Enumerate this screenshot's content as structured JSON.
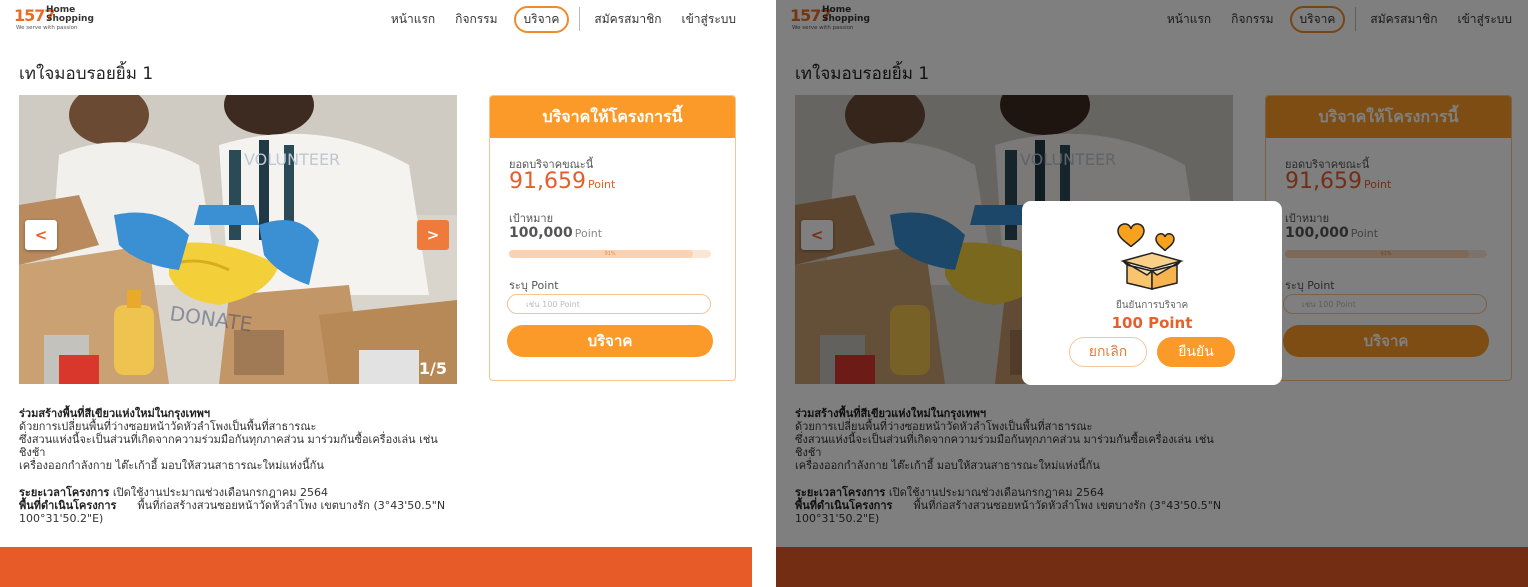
{
  "header": {
    "logo_number": "1577",
    "logo_brand": [
      "Home",
      "Shopping"
    ],
    "logo_tagline": "We serve with passion",
    "nav": [
      "หน้าแรก",
      "กิจกรรม",
      "บริจาค",
      "สมัครสมาชิก",
      "เข้าสู่ระบบ"
    ],
    "active_nav": "บริจาค"
  },
  "page_title": "เทใจมอบรอยยิ้ม 1",
  "slider": {
    "prev_icon": "chevron-left-icon",
    "next_icon": "chevron-right-icon",
    "prev_label": "<",
    "next_label": ">",
    "counter": "1/5"
  },
  "donate_card": {
    "heading": "บริจาคให้โครงการนี้",
    "current_label": "ยอดบริจาคขณะนี้",
    "current_value": "91,659",
    "unit": "Point",
    "goal_label": "เป้าหมาย",
    "goal_value": "100,000",
    "progress_pct": 91,
    "progress_text": "91%",
    "input_label": "ระบุ Point",
    "input_placeholder": "เช่น 100 Point",
    "button_label": "บริจาค"
  },
  "description": {
    "heading": "ร่วมสร้างพื้นที่สีเขียวแห่งใหม่ในกรุงเทพฯ",
    "lines": [
      "ด้วยการเปลี่ยนพื้นที่ว่างซอยหน้าวัดหัวลำโพงเป็นพื้นที่สาธารณะ",
      "ซึ่งสวนแห่งนี้จะเป็นส่วนที่เกิดจากความร่วมมือกันทุกภาคส่วน  มาร่วมกันซื้อเครื่องเล่น  เช่น  ชิงช้า",
      "เครื่องออกกำลังกาย ไต๊ะเก้าอี้ มอบให้สวนสาธารณะใหม่แห่งนี้กัน"
    ],
    "period_label": "ระยะเวลาโครงการ",
    "period_value": "เปิดใช้งานประมาณช่วงเดือนกรกฎาคม 2564",
    "location_label": "พื้นที่ดำเนินโครงการ",
    "location_value": "พื้นที่ก่อสร้างสวนซอยหน้าวัดหัวลำโพง      เขตบางรัก      (3°43'50.5\"N",
    "location_value_2": "100°31'50.2\"E)"
  },
  "modal": {
    "icon": "heart-box-icon",
    "confirm_label": "ยืนยันการบริจาค",
    "amount": "100 Point",
    "cancel_label": "ยกเลิก",
    "ok_label": "ยืนยัน"
  },
  "colors": {
    "accent": "#fb9a28",
    "accent_dark": "#e65b27",
    "overlay": "rgba(0,0,0,0.5)"
  }
}
